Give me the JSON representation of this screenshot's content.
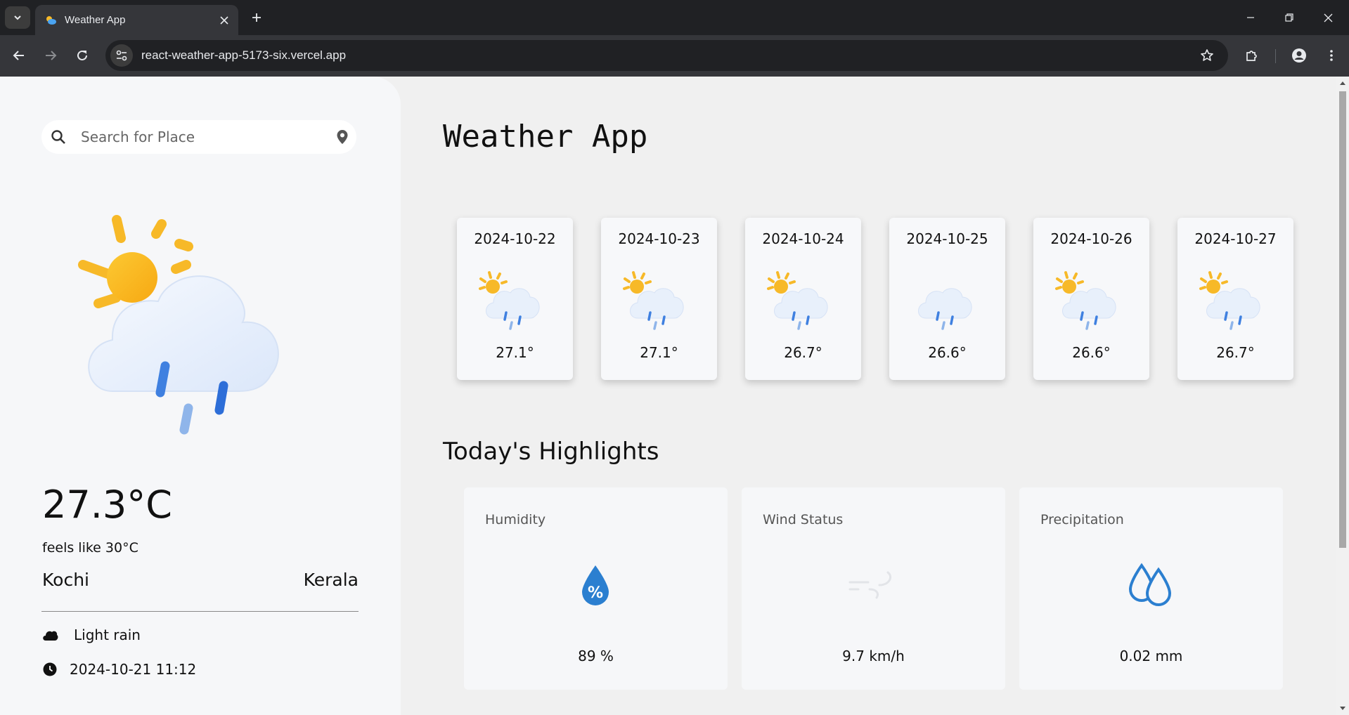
{
  "browser": {
    "tab_title": "Weather App",
    "url": "react-weather-app-5173-six.vercel.app"
  },
  "sidebar": {
    "search_placeholder": "Search for Place",
    "current_temp": "27.3°C",
    "feels_like": "feels like 30°C",
    "city": "Kochi",
    "region": "Kerala",
    "condition": "Light rain",
    "datetime": "2024-10-21 11:12"
  },
  "main": {
    "title": "Weather App",
    "highlights_title": "Today's Highlights"
  },
  "forecast": [
    {
      "date": "2024-10-22",
      "temp": "27.1°",
      "icon": "sun-cloud-rain-icon"
    },
    {
      "date": "2024-10-23",
      "temp": "27.1°",
      "icon": "sun-cloud-rain-icon"
    },
    {
      "date": "2024-10-24",
      "temp": "26.7°",
      "icon": "sun-cloud-rain-icon"
    },
    {
      "date": "2024-10-25",
      "temp": "26.6°",
      "icon": "cloud-rain-icon"
    },
    {
      "date": "2024-10-26",
      "temp": "26.6°",
      "icon": "sun-cloud-rain-icon"
    },
    {
      "date": "2024-10-27",
      "temp": "26.7°",
      "icon": "sun-cloud-rain-icon"
    }
  ],
  "highlights": [
    {
      "label": "Humidity",
      "value": "89 %",
      "icon": "humidity-drop-icon"
    },
    {
      "label": "Wind Status",
      "value": "9.7 km/h",
      "icon": "wind-icon"
    },
    {
      "label": "Precipitation",
      "value": "0.02 mm",
      "icon": "raindrops-icon"
    }
  ],
  "colors": {
    "sun": "#f7b928",
    "cloud": "#e8f0fb",
    "rain": "#3f80e0",
    "accent_blue": "#2b7fd0"
  }
}
